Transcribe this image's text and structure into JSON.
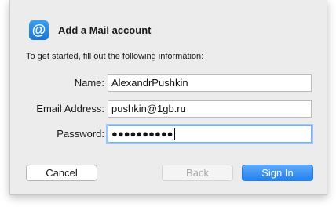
{
  "dialog": {
    "title": "Add a Mail account",
    "icon": "at-sign-icon",
    "icon_glyph": "@",
    "intro": "To get started, fill out the following information:"
  },
  "form": {
    "name_label": "Name:",
    "name_value": "AlexandrPushkin",
    "email_label": "Email Address:",
    "email_value": "pushkin@1gb.ru",
    "password_label": "Password:",
    "password_masked": "●●●●●●●●●●"
  },
  "buttons": {
    "cancel": "Cancel",
    "back": "Back",
    "sign_in": "Sign In"
  },
  "colors": {
    "accent": "#2380ef",
    "focus_ring": "#9fc6f3"
  }
}
